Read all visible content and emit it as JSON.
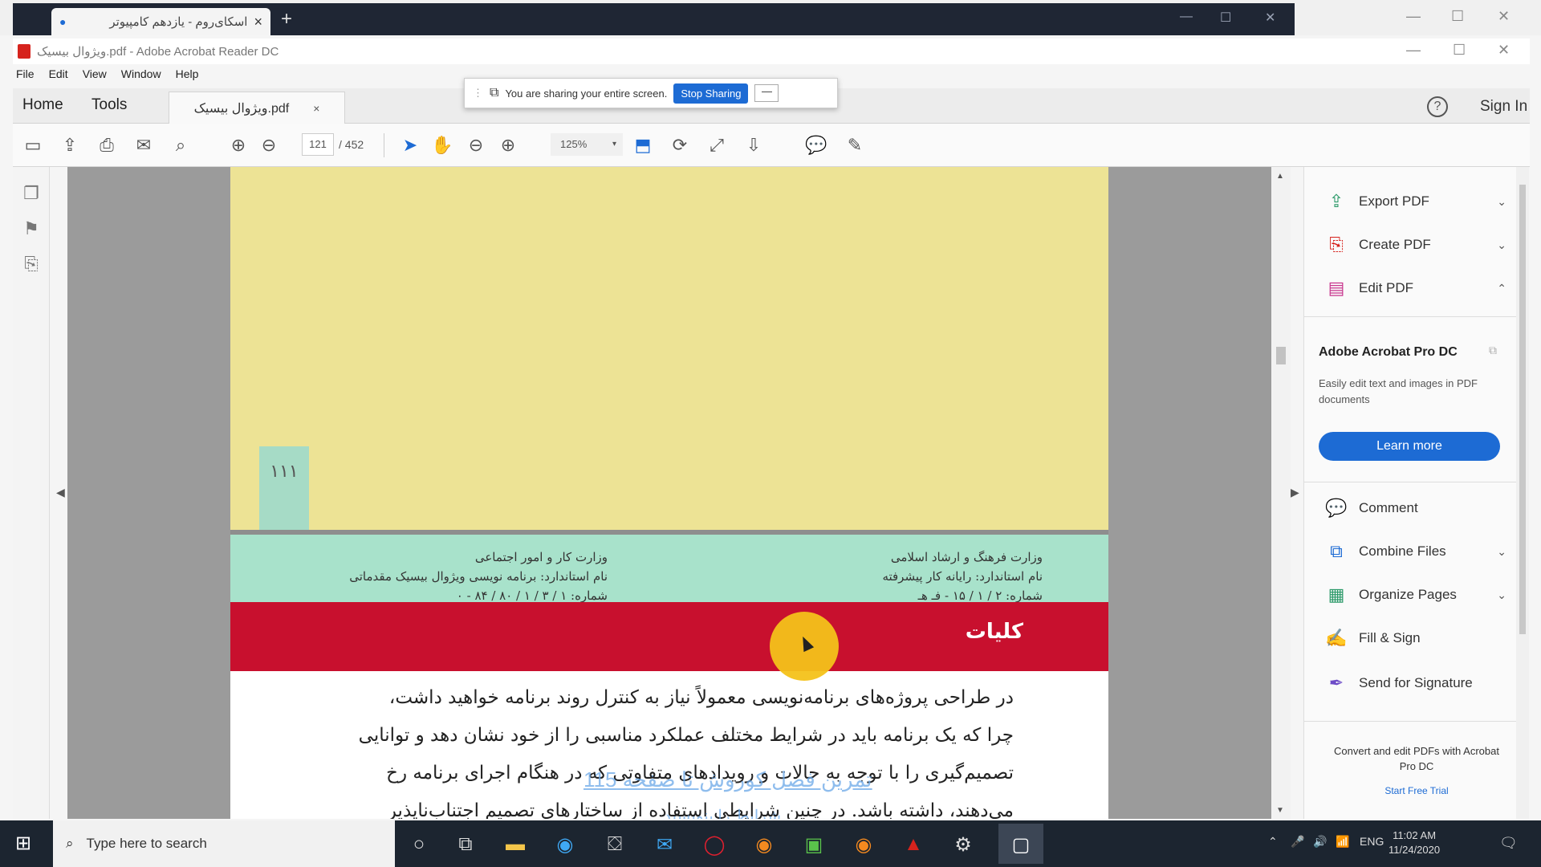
{
  "browser": {
    "tab_title": "اسکای‌روم - یازدهم کامپیوتر",
    "new_tab_label": "+"
  },
  "app": {
    "title": "ویژوال بیسیک.pdf - Adobe Acrobat Reader DC",
    "menu": [
      "File",
      "Edit",
      "View",
      "Window",
      "Help"
    ]
  },
  "share_banner": {
    "message": "You are sharing your entire screen.",
    "stop_label": "Stop Sharing",
    "hide_label": "—"
  },
  "nav": {
    "home": "Home",
    "tools": "Tools",
    "doc_tab": "ویژوال بیسیک.pdf",
    "doc_close": "×",
    "help": "?",
    "sign_in": "Sign In"
  },
  "toolbar": {
    "page_current": "121",
    "page_total": "/ 452",
    "zoom": "125%",
    "zoom_caret": "▾"
  },
  "document": {
    "page_number": "۱۱۱",
    "header_right": [
      "وزارت فرهنگ و ارشاد اسلامی",
      "نام استاندارد: رایانه کار پیشرفته",
      "شماره: ۲ / ۱ / ۱۵ - فـ هـ"
    ],
    "header_left": [
      "وزارت کار و امور اجتماعی",
      "نام استاندارد: برنامه نویسی ویژوال بیسیک مقدماتی",
      "شماره: ۱ / ۳ / ۱ / ۸۰ / ۸۴ - ۰"
    ],
    "section_title": "کلیات",
    "body_lines": [
      "در طراحی پروژه‌های برنامه‌نویسی معمولاً نیاز به کنترل روند برنامه خواهید داشت،",
      "چرا که یک برنامه باید در شرایط مختلف عملکرد مناسبی را از خود نشان دهد و توانایی",
      "تصمیم‌گیری را با توجه به حالات و رویدادهای متفاوتی که در هنگام اجرای برنامه رخ",
      "می‌دهند، داشته باشد. در چنین شرایطی استفاده از ساختارهای تصمیم اجتناب‌ناپذیر"
    ],
    "overlay_link": "تمرین فصل کوروش تا صفحه 115",
    "overlay_link2": "شرایط را بنویسید"
  },
  "right_pane": {
    "tools": [
      {
        "label": "Export PDF",
        "icon": "export-pdf-icon",
        "chevron": "⌄",
        "color": "#2d9a6a"
      },
      {
        "label": "Create PDF",
        "icon": "create-pdf-icon",
        "chevron": "⌄",
        "color": "#d6231d"
      },
      {
        "label": "Edit PDF",
        "icon": "edit-pdf-icon",
        "chevron": "⌃",
        "color": "#c8378e"
      }
    ],
    "promo_title": "Adobe Acrobat Pro DC",
    "promo_desc": "Easily edit text and images in PDF documents",
    "learn_more": "Learn more",
    "more_tools": [
      {
        "label": "Comment",
        "icon": "comment-icon",
        "chevron": "",
        "color": "#e8b21a"
      },
      {
        "label": "Combine Files",
        "icon": "combine-files-icon",
        "chevron": "⌄",
        "color": "#1d6bd4"
      },
      {
        "label": "Organize Pages",
        "icon": "organize-pages-icon",
        "chevron": "⌄",
        "color": "#2d9a6a"
      },
      {
        "label": "Fill & Sign",
        "icon": "fill-sign-icon",
        "chevron": "",
        "color": "#6d4bc7"
      },
      {
        "label": "Send for Signature",
        "icon": "send-signature-icon",
        "chevron": "",
        "color": "#6d4bc7"
      }
    ],
    "footer": "Convert and edit PDFs with Acrobat Pro DC",
    "trial": "Start Free Trial"
  },
  "taskbar": {
    "search_placeholder": "Type here to search",
    "language": "ENG",
    "time": "11:02 AM",
    "date": "11/24/2020"
  },
  "colors": {
    "accent_blue": "#1d6bd4",
    "page_yellow": "#ede395",
    "header_green": "#a8e2cb",
    "section_red": "#c8102e"
  }
}
